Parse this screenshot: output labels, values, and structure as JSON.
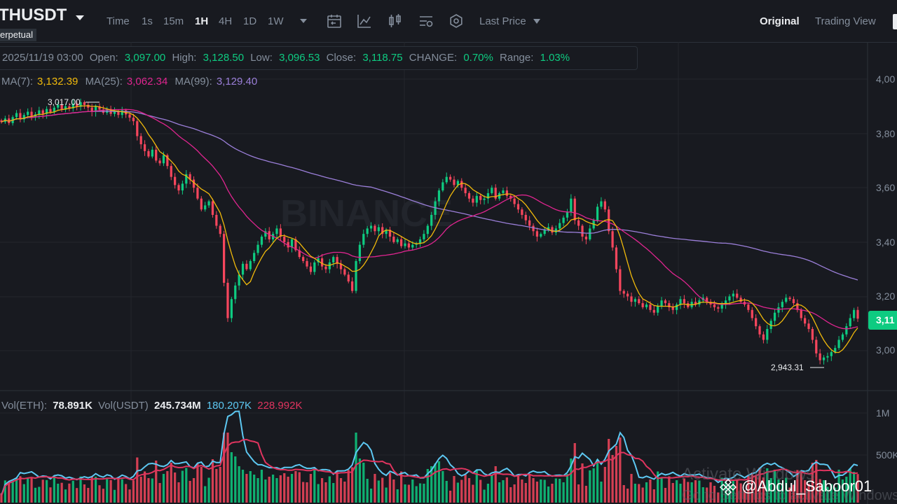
{
  "toolbar": {
    "symbol": "THUSDT",
    "contract_type": "erpetual",
    "timeframes": [
      "Time",
      "1s",
      "15m",
      "1H",
      "4H",
      "1D",
      "1W"
    ],
    "active_timeframe": "1H",
    "price_source": "Last Price",
    "view_original": "Original",
    "view_trading": "Trading View",
    "icons": [
      "calendar-icon",
      "line-chart-icon",
      "candles-icon",
      "indicator-settings-icon",
      "settings-icon"
    ]
  },
  "ohlc": {
    "date": "2025/11/19 03:00",
    "open_label": "Open:",
    "open": "3,097.00",
    "high_label": "High:",
    "high": "3,128.50",
    "low_label": "Low:",
    "low": "3,096.53",
    "close_label": "Close:",
    "close": "3,118.75",
    "change_label": "CHANGE:",
    "change": "0.70%",
    "range_label": "Range:",
    "range": "1.03%"
  },
  "ma": {
    "ma7_label": "MA(7):",
    "ma7": "3,132.39",
    "ma25_label": "MA(25):",
    "ma25": "3,062.34",
    "ma99_label": "MA(99):",
    "ma99": "3,129.40"
  },
  "volume": {
    "eth_label": "Vol(ETH):",
    "eth": "78.891K",
    "usdt_label": "Vol(USDT)",
    "usdt": "245.734M",
    "ma1": "180.207K",
    "ma2": "228.992K",
    "axis": [
      "1M",
      "500K"
    ]
  },
  "price_axis": [
    "4,00",
    "3,80",
    "3,60",
    "3,40",
    "3,20",
    "3,00"
  ],
  "price_tag": "3,11",
  "annotations": {
    "high": "3,017.00",
    "low": "2,943.31"
  },
  "watermark": "BINANCE",
  "overlay": {
    "activate_title": "Activate Windows",
    "activate_sub": "Go to Settings to activate Windows",
    "user": "@Abdul_Saboor01"
  },
  "colors": {
    "up": "#0ecb81",
    "down": "#f6465d",
    "ma7": "#f0b90b",
    "ma25": "#e02590",
    "ma99": "#9b7fd9",
    "vol_ma1": "#5dc8f2",
    "vol_ma2": "#e0345f"
  },
  "chart_data": {
    "type": "candlestick",
    "y_range": [
      2900,
      4050
    ],
    "closes": [
      3842,
      3855,
      3838,
      3860,
      3875,
      3852,
      3868,
      3880,
      3862,
      3870,
      3885,
      3872,
      3890,
      3878,
      3895,
      3905,
      3888,
      3900,
      3892,
      3910,
      3898,
      3915,
      3905,
      3895,
      3880,
      3900,
      3888,
      3876,
      3890,
      3872,
      3880,
      3868,
      3885,
      3870,
      3858,
      3845,
      3790,
      3760,
      3735,
      3715,
      3740,
      3700,
      3690,
      3720,
      3680,
      3640,
      3610,
      3590,
      3615,
      3650,
      3630,
      3600,
      3560,
      3520,
      3535,
      3550,
      3500,
      3460,
      3430,
      3250,
      3120,
      3190,
      3240,
      3280,
      3320,
      3300,
      3330,
      3360,
      3390,
      3420,
      3440,
      3410,
      3430,
      3450,
      3420,
      3400,
      3380,
      3410,
      3370,
      3345,
      3330,
      3310,
      3290,
      3325,
      3340,
      3310,
      3300,
      3325,
      3345,
      3320,
      3300,
      3280,
      3255,
      3220,
      3330,
      3390,
      3430,
      3450,
      3460,
      3440,
      3455,
      3430,
      3445,
      3420,
      3400,
      3410,
      3385,
      3395,
      3380,
      3390,
      3395,
      3410,
      3430,
      3460,
      3500,
      3550,
      3590,
      3620,
      3640,
      3630,
      3610,
      3625,
      3600,
      3580,
      3560,
      3545,
      3570,
      3555,
      3560,
      3580,
      3600,
      3560,
      3580,
      3590,
      3570,
      3560,
      3540,
      3520,
      3500,
      3480,
      3460,
      3440,
      3420,
      3430,
      3445,
      3455,
      3435,
      3450,
      3470,
      3490,
      3510,
      3560,
      3480,
      3460,
      3420,
      3410,
      3450,
      3480,
      3530,
      3550,
      3520,
      3440,
      3380,
      3300,
      3220,
      3210,
      3200,
      3180,
      3190,
      3175,
      3160,
      3170,
      3150,
      3140,
      3165,
      3185,
      3175,
      3160,
      3150,
      3170,
      3190,
      3175,
      3160,
      3180,
      3170,
      3185,
      3195,
      3180,
      3170,
      3160,
      3155,
      3170,
      3185,
      3200,
      3210,
      3195,
      3180,
      3170,
      3150,
      3120,
      3090,
      3060,
      3040,
      3080,
      3110,
      3140,
      3160,
      3180,
      3195,
      3190,
      3175,
      3150,
      3120,
      3100,
      3080,
      3040,
      2990,
      2965,
      2975,
      2980,
      2995,
      3010,
      3040,
      3060,
      3090,
      3120,
      3150,
      3118
    ]
  }
}
